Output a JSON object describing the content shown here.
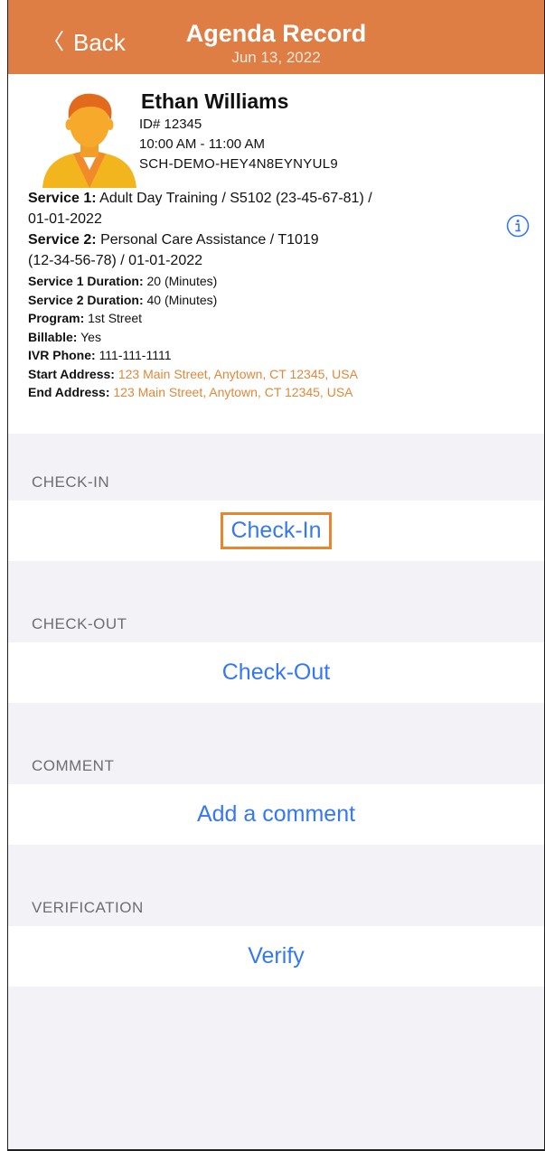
{
  "navbar": {
    "back_label": "Back",
    "title": "Agenda Record",
    "date": "Jun 13, 2022"
  },
  "client": {
    "name": "Ethan Williams",
    "id": "ID# 12345",
    "time": "10:00 AM - 11:00 AM",
    "schedule_code": "SCH-DEMO-HEY4N8EYNYUL9"
  },
  "details": {
    "service1_label": "Service 1:",
    "service1_value_a": "Adult Day Training / S5102 (23-45-67-81) /",
    "service1_value_b": "01-01-2022",
    "service2_label": "Service 2:",
    "service2_value_a": "Personal Care Assistance / T1019",
    "service2_value_b": "(12-34-56-78) /  01-01-2022",
    "service1_duration_label": "Service 1 Duration:",
    "service1_duration": "20 (Minutes)",
    "service2_duration_label": "Service 2 Duration:",
    "service2_duration": "40 (Minutes)",
    "program_label": "Program:",
    "program": "1st Street",
    "billable_label": "Billable:",
    "billable": "Yes",
    "ivr_label": "IVR Phone:",
    "ivr": "111-111-1111",
    "start_address_label": "Start Address:",
    "start_address": "123 Main Street, Anytown, CT 12345, USA",
    "end_address_label": "End Address:",
    "end_address": "123 Main Street, Anytown, CT 12345, USA"
  },
  "sections": {
    "checkin_header": "CHECK-IN",
    "checkin_action": "Check-In",
    "checkout_header": "CHECK-OUT",
    "checkout_action": "Check-Out",
    "comment_header": "COMMENT",
    "comment_action": "Add a comment",
    "verification_header": "VERIFICATION",
    "verification_action": "Verify"
  },
  "colors": {
    "nav_bar": "#de7e45",
    "link_blue": "#3478f6",
    "address_orange": "#e08838",
    "highlight_border": "#e8852f",
    "section_gray": "#f2f2f7"
  },
  "icons": {
    "back": "chevron-left-icon",
    "info": "info-circle-icon",
    "avatar": "user-avatar-icon"
  }
}
